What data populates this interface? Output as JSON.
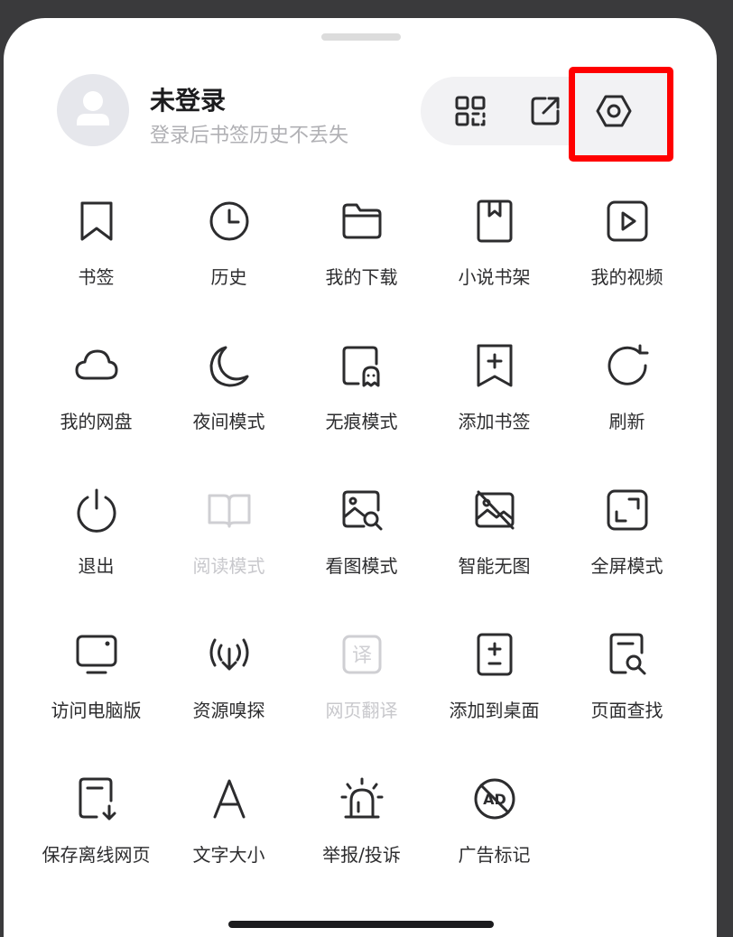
{
  "header": {
    "user_name": "未登录",
    "user_subtitle": "登录后书签历史不丢失",
    "actions": [
      {
        "icon": "scan-icon"
      },
      {
        "icon": "share-icon"
      },
      {
        "icon": "settings-icon"
      }
    ]
  },
  "menu": {
    "items": [
      {
        "label": "书签",
        "icon": "bookmark-icon",
        "enabled": true
      },
      {
        "label": "历史",
        "icon": "clock-icon",
        "enabled": true
      },
      {
        "label": "我的下载",
        "icon": "folder-icon",
        "enabled": true
      },
      {
        "label": "小说书架",
        "icon": "book-shelf-icon",
        "enabled": true
      },
      {
        "label": "我的视频",
        "icon": "video-icon",
        "enabled": true
      },
      {
        "label": "我的网盘",
        "icon": "cloud-icon",
        "enabled": true
      },
      {
        "label": "夜间模式",
        "icon": "moon-icon",
        "enabled": true
      },
      {
        "label": "无痕模式",
        "icon": "ghost-icon",
        "enabled": true
      },
      {
        "label": "添加书签",
        "icon": "add-bookmark-icon",
        "enabled": true
      },
      {
        "label": "刷新",
        "icon": "refresh-icon",
        "enabled": true
      },
      {
        "label": "退出",
        "icon": "power-icon",
        "enabled": true
      },
      {
        "label": "阅读模式",
        "icon": "open-book-icon",
        "enabled": false
      },
      {
        "label": "看图模式",
        "icon": "image-search-icon",
        "enabled": true
      },
      {
        "label": "智能无图",
        "icon": "no-image-icon",
        "enabled": true
      },
      {
        "label": "全屏模式",
        "icon": "fullscreen-icon",
        "enabled": true
      },
      {
        "label": "访问电脑版",
        "icon": "desktop-icon",
        "enabled": true
      },
      {
        "label": "资源嗅探",
        "icon": "sniff-icon",
        "enabled": true
      },
      {
        "label": "网页翻译",
        "icon": "translate-icon",
        "enabled": false
      },
      {
        "label": "添加到桌面",
        "icon": "add-desktop-icon",
        "enabled": true
      },
      {
        "label": "页面查找",
        "icon": "page-search-icon",
        "enabled": true
      },
      {
        "label": "保存离线网页",
        "icon": "save-offline-icon",
        "enabled": true
      },
      {
        "label": "文字大小",
        "icon": "font-size-icon",
        "enabled": true
      },
      {
        "label": "举报/投诉",
        "icon": "alarm-icon",
        "enabled": true
      },
      {
        "label": "广告标记",
        "icon": "ad-block-icon",
        "enabled": true
      }
    ],
    "icon_glyphs": {
      "translate": "译",
      "ad": "AD"
    }
  },
  "colors": {
    "highlight": "#ff0000",
    "text": "#2c2c2e",
    "disabled_text": "#c8c8cc",
    "subtitle": "#b0b0b4"
  }
}
